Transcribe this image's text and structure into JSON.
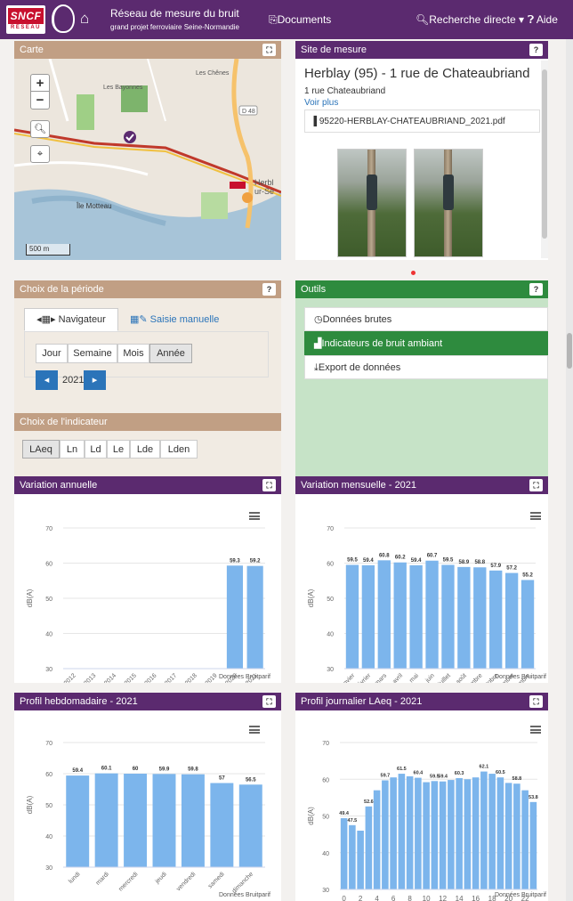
{
  "header": {
    "logo_text": "SNCF",
    "logo_subtext": "RÉSEAU",
    "title": "Réseau de mesure du bruit",
    "subtitle": "grand projet ferroviaire Seine-Normandie",
    "documents": "Documents",
    "search": "Recherche directe",
    "help": "Aide"
  },
  "map_panel": {
    "title": "Carte",
    "scale": "500 m",
    "labels": [
      "Les Chênes",
      "Les Bayonnes",
      "Herbl",
      "ur-Se",
      "Île Motteau"
    ],
    "road_badge": "D 48"
  },
  "site_panel": {
    "title": "Site de mesure",
    "site_name": "Herblay (95) - 1 rue de Chateaubriand",
    "address": "1 rue Chateaubriand",
    "more_link": "Voir plus",
    "pdf_file": "95220-HERBLAY-CHATEAUBRIAND_2021.pdf"
  },
  "period_panel": {
    "title": "Choix de la période",
    "tab_navigator": "Navigateur",
    "tab_manual": "Saisie manuelle",
    "periods": [
      "Jour",
      "Semaine",
      "Mois",
      "Année"
    ],
    "selected_period": "Année",
    "year": "2021"
  },
  "indicator_panel": {
    "title": "Choix de l'indicateur",
    "indicators": [
      "LAeq",
      "Ln",
      "Ld",
      "Le",
      "Lde",
      "Lden"
    ],
    "selected": "LAeq"
  },
  "tools_panel": {
    "title": "Outils",
    "items": [
      "Données brutes",
      "Indicateurs de bruit ambiant",
      "Export de données"
    ],
    "active_item": "Indicateurs de bruit ambiant"
  },
  "colors": {
    "purple": "#5b2a6f",
    "brown": "#c19f84",
    "green": "#2e8b3e",
    "bar": "#7cb5ec",
    "link": "#2b74b9"
  },
  "chart_data": [
    {
      "type": "bar",
      "title": "Variation annuelle",
      "ylabel": "dB(A)",
      "ylim": [
        30,
        70
      ],
      "yticks": [
        30,
        40,
        50,
        60,
        70
      ],
      "categories": [
        "2012",
        "2013",
        "2014",
        "2015",
        "2016",
        "2017",
        "2018",
        "2019",
        "2020",
        "2021"
      ],
      "values": [
        null,
        null,
        null,
        null,
        null,
        null,
        null,
        null,
        59.3,
        59.2
      ],
      "labels": [
        null,
        null,
        null,
        null,
        null,
        null,
        null,
        null,
        "59.3",
        "59.2"
      ],
      "credit": "Données Bruitparif",
      "grid": true
    },
    {
      "type": "bar",
      "title": "Variation mensuelle - 2021",
      "ylabel": "dB(A)",
      "ylim": [
        30,
        70
      ],
      "yticks": [
        30,
        40,
        50,
        60,
        70
      ],
      "categories": [
        "janvier",
        "février",
        "mars",
        "avril",
        "mai",
        "juin",
        "juillet",
        "août",
        "septembre",
        "octobre",
        "novembre",
        "décembre"
      ],
      "values": [
        59.5,
        59.4,
        60.8,
        60.2,
        59.4,
        60.7,
        59.5,
        58.9,
        58.8,
        57.9,
        57.2,
        55.2
      ],
      "labels": [
        "59.5",
        "59.4",
        "60.8",
        "60.2",
        "59.4",
        "60.7",
        "59.5",
        "58.9",
        "58.8",
        "57.9",
        "57.2",
        "55.2"
      ],
      "credit": "Données Bruitparif",
      "grid": true
    },
    {
      "type": "bar",
      "title": "Profil hebdomadaire - 2021",
      "ylabel": "dB(A)",
      "ylim": [
        30,
        70
      ],
      "yticks": [
        30,
        40,
        50,
        60,
        70
      ],
      "categories": [
        "lundi",
        "mardi",
        "mercredi",
        "jeudi",
        "vendredi",
        "samedi",
        "dimanche"
      ],
      "values": [
        59.4,
        60.1,
        60,
        59.9,
        59.8,
        57,
        56.5
      ],
      "labels": [
        "59.4",
        "60.1",
        "60",
        "59.9",
        "59.8",
        "57",
        "56.5"
      ],
      "credit": "Données Bruitparif",
      "grid": true
    },
    {
      "type": "bar",
      "title": "Profil journalier LAeq - 2021",
      "ylabel": "dB(A)",
      "ylim": [
        30,
        70
      ],
      "yticks": [
        30,
        40,
        50,
        60,
        70
      ],
      "categories": [
        "0",
        "1",
        "2",
        "3",
        "4",
        "5",
        "6",
        "7",
        "8",
        "9",
        "10",
        "11",
        "12",
        "13",
        "14",
        "15",
        "16",
        "17",
        "18",
        "19",
        "20",
        "21",
        "22",
        "23"
      ],
      "xtick_labels": [
        "0",
        "2",
        "4",
        "6",
        "8",
        "10",
        "12",
        "14",
        "16",
        "18",
        "20",
        "22"
      ],
      "values": [
        49.4,
        47.5,
        46,
        52.6,
        57,
        59.7,
        60.5,
        61.5,
        60.8,
        60.4,
        59.2,
        59.5,
        59.4,
        59.8,
        60.3,
        60,
        60.5,
        62.1,
        61.5,
        60.5,
        59,
        58.8,
        57,
        53.8
      ],
      "labels": [
        "49.4",
        "47.5",
        null,
        "52.6",
        null,
        "59.7",
        null,
        "61.5",
        null,
        "60.4",
        null,
        "59.5",
        "59.4",
        null,
        "60.3",
        null,
        null,
        "62.1",
        null,
        "60.5",
        null,
        "58.8",
        null,
        "53.8"
      ],
      "credit": "Données Bruitparif",
      "grid": true
    }
  ]
}
